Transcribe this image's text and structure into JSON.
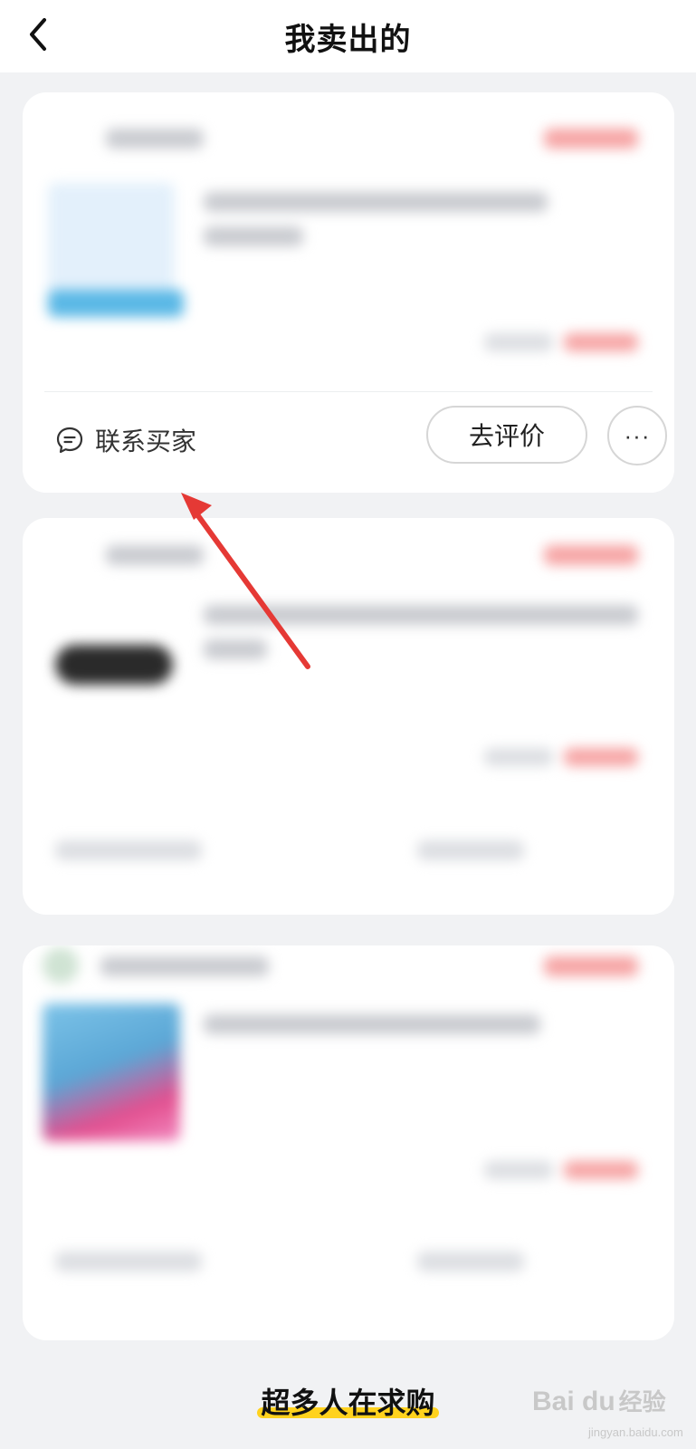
{
  "header": {
    "title": "我卖出的"
  },
  "order_card": {
    "contact_label": "联系买家",
    "review_label": "去评价",
    "more_label": "···"
  },
  "footer": {
    "banner_text": "超多人在求购"
  },
  "watermark": {
    "brand": "Bai du",
    "name": "经验",
    "url": "jingyan.baidu.com"
  },
  "colors": {
    "accent_yellow": "#ffd21e",
    "annotation_red": "#e53935",
    "price_red": "#f6a4a4"
  }
}
